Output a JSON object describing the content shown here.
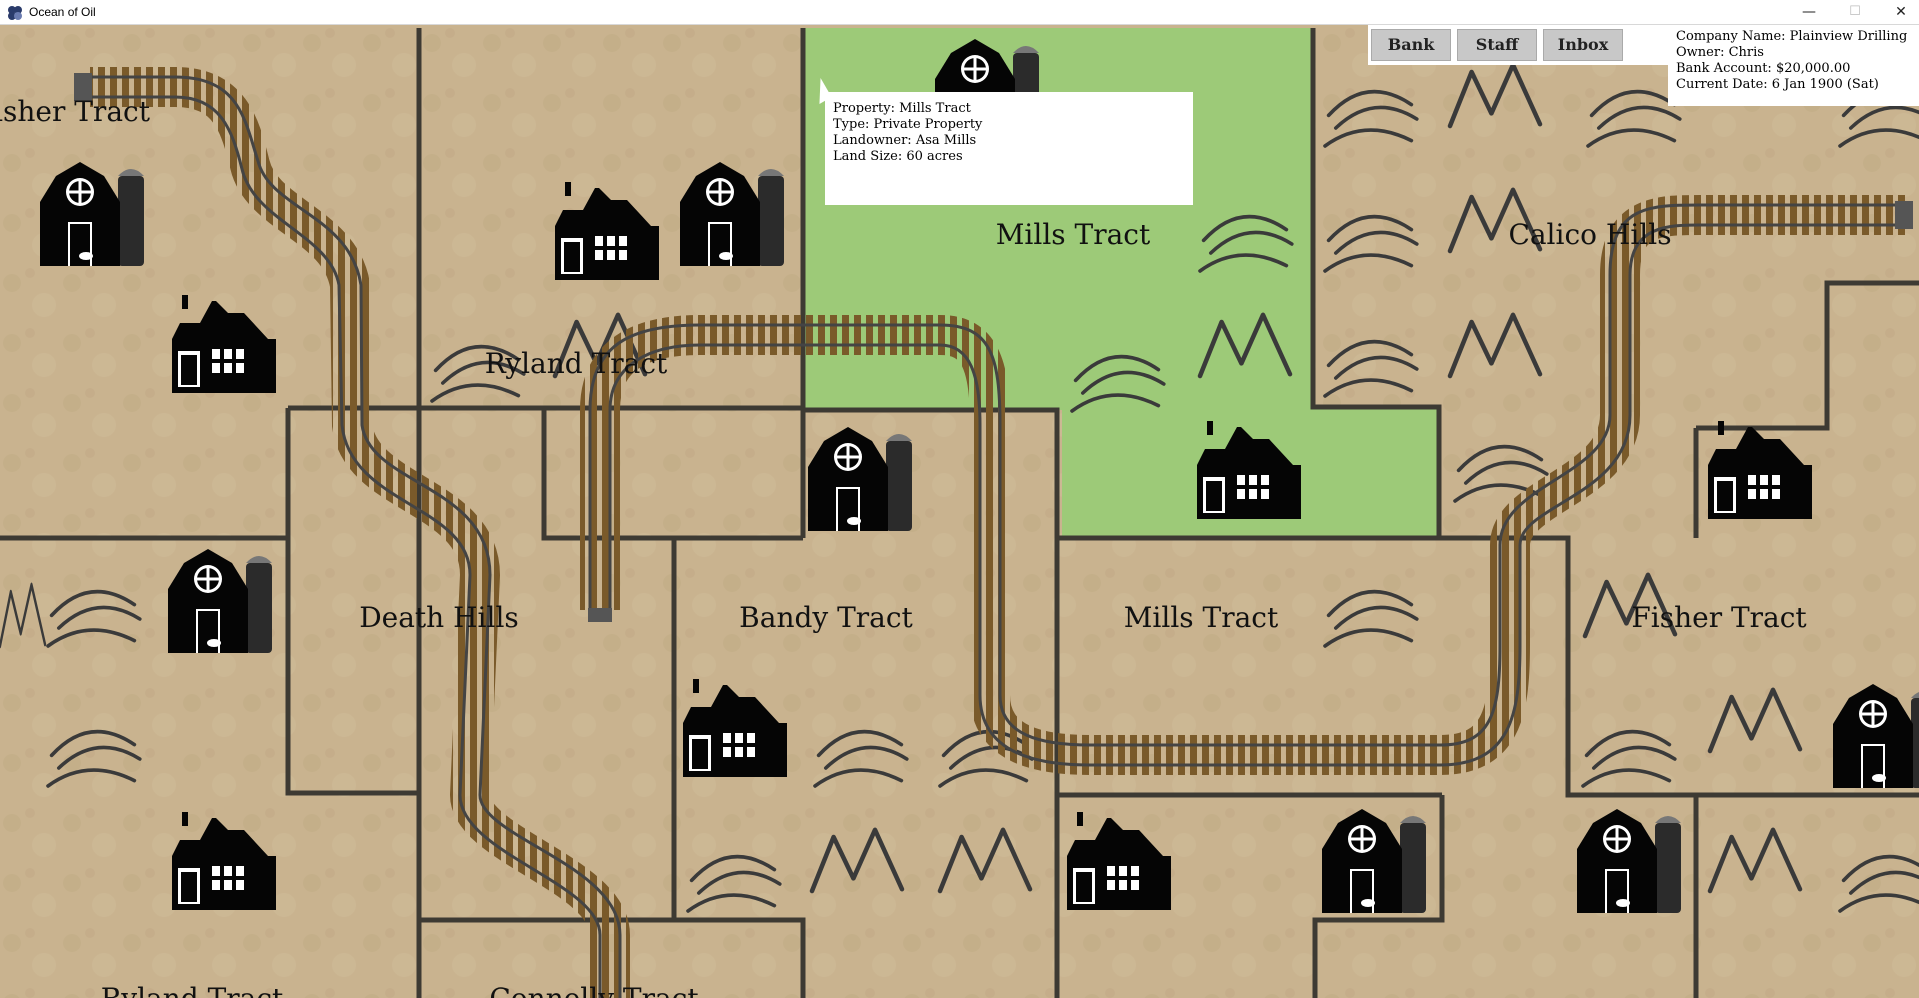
{
  "window": {
    "title": "Ocean of Oil",
    "minimize": "—",
    "maximize": "☐",
    "close": "✕"
  },
  "toolbar": {
    "bank_label": "Bank",
    "staff_label": "Staff",
    "inbox_label": "Inbox"
  },
  "company": {
    "name_line": "Company Name: Plainview Drilling",
    "owner_line": "Owner: Chris",
    "bank_line": "Bank Account: $20,000.00",
    "date_line": "Current Date: 6 Jan 1900 (Sat)"
  },
  "tooltip": {
    "property_line": "Property: Mills Tract",
    "type_line": "Type: Private Property",
    "landowner_line": "Landowner: Asa Mills",
    "size_line": "Land Size: 60 acres"
  },
  "tracts": [
    {
      "id": "fisher-tract-top",
      "label": "isher Tract"
    },
    {
      "id": "ryland-tract",
      "label": "Ryland Tract"
    },
    {
      "id": "mills-tract-selected",
      "label": "Mills Tract"
    },
    {
      "id": "calico-hills",
      "label": "Calico Hills"
    },
    {
      "id": "death-hills",
      "label": "Death Hills"
    },
    {
      "id": "bandy-tract",
      "label": "Bandy Tract"
    },
    {
      "id": "mills-tract-lower",
      "label": "Mills Tract"
    },
    {
      "id": "fisher-tract-right",
      "label": "Fisher Tract"
    },
    {
      "id": "ryland-tract-bottom",
      "label": "Ryland Tract"
    },
    {
      "id": "connelly-tract",
      "label": "Connelly Tract"
    }
  ],
  "colors": {
    "land": "#c8b28e",
    "selected_land": "#9ccb7a",
    "border": "#3d3a33",
    "track_tie": "#7a5a2a",
    "track_rail": "#555555"
  },
  "icons": [
    "barn-icon",
    "farmhouse-icon",
    "hills-icon",
    "mountains-icon",
    "railroad-track"
  ]
}
